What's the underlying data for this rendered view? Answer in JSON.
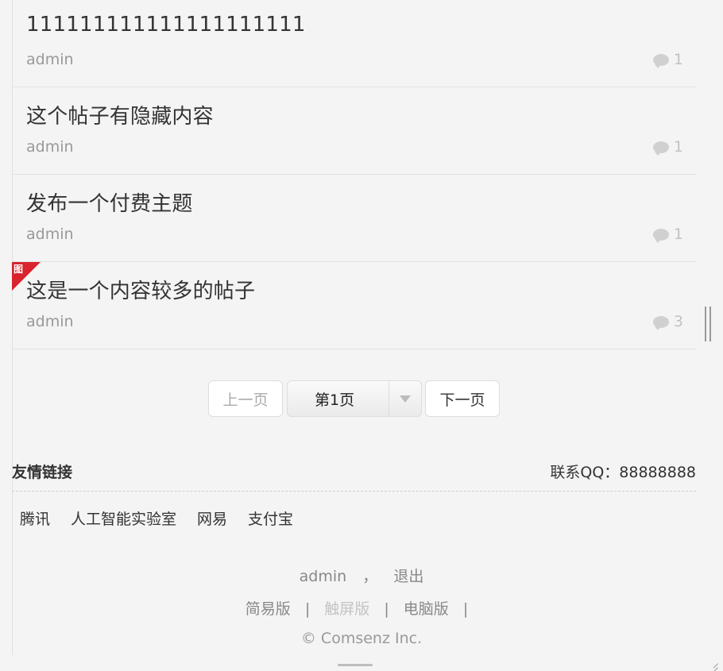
{
  "threads": [
    {
      "title": "111111111111111111111",
      "author": "admin",
      "replies": "1",
      "has_image": false
    },
    {
      "title": "这个帖子有隐藏内容",
      "author": "admin",
      "replies": "1",
      "has_image": false
    },
    {
      "title": "发布一个付费主题",
      "author": "admin",
      "replies": "1",
      "has_image": false
    },
    {
      "title": "这是一个内容较多的帖子",
      "author": "admin",
      "replies": "3",
      "has_image": true,
      "badge": "图"
    }
  ],
  "pager": {
    "prev": "上一页",
    "current": "第1页",
    "next": "下一页"
  },
  "links": {
    "title": "友情链接",
    "qq": "联系QQ：88888888",
    "items": [
      "腾讯",
      "人工智能实验室",
      "网易",
      "支付宝"
    ]
  },
  "footer": {
    "user": "admin",
    "comma": "，",
    "logout": "退出",
    "simple": "简易版",
    "touch": "触屏版",
    "pc": "电脑版",
    "sep": "|",
    "copyright": "© Comsenz Inc."
  },
  "colors": {
    "accent_red": "#d9232d",
    "muted_text": "#999999"
  },
  "icons": {
    "reply": "comment-bubble-icon",
    "dropdown": "chevron-down-icon",
    "image_badge": "image-badge-icon"
  }
}
